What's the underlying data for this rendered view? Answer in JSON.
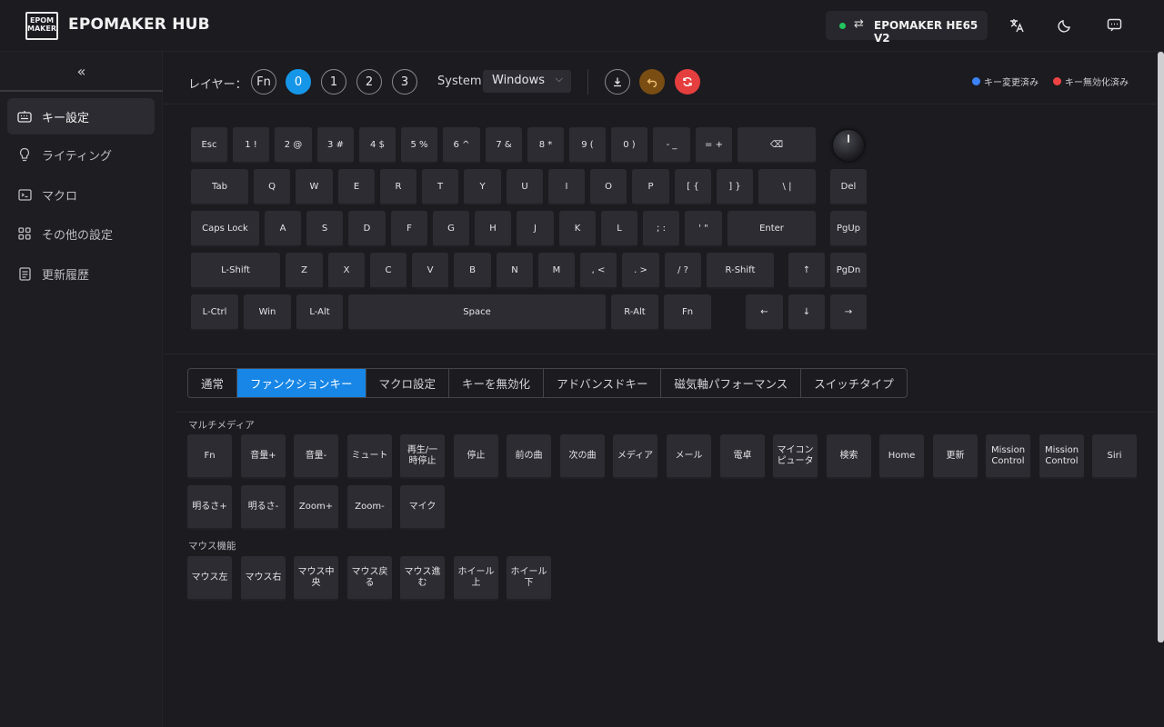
{
  "app": {
    "logo_text": "EPOM\nMAKER",
    "title": "EPOMAKER HUB"
  },
  "device": {
    "name": "EPOMAKER HE65 V2",
    "status_color": "#22c55e"
  },
  "sidebar": {
    "collapse_glyph": "«",
    "items": [
      {
        "label": "キー設定",
        "icon": "keyboard-icon",
        "active": true
      },
      {
        "label": "ライティング",
        "icon": "bulb-icon",
        "active": false
      },
      {
        "label": "マクロ",
        "icon": "terminal-icon",
        "active": false
      },
      {
        "label": "その他の設定",
        "icon": "grid-icon",
        "active": false
      },
      {
        "label": "更新履歴",
        "icon": "document-icon",
        "active": false
      }
    ]
  },
  "toolbar": {
    "layer_label": "レイヤー：",
    "layers": [
      "Fn",
      "0",
      "1",
      "2",
      "3"
    ],
    "active_layer": "0",
    "system_label": "System",
    "system_value": "Windows",
    "legend_remapped": "キー変更済み",
    "legend_disabled": "キー無効化済み",
    "colors": {
      "accent": "#1696e8",
      "remapped": "#3b82f6",
      "disabled": "#ef4444",
      "restore": "#7a4e12",
      "reset": "#e53e3e"
    }
  },
  "keyboard": {
    "rows": [
      [
        "Esc",
        "1 !",
        "2 @",
        "3 #",
        "4 $",
        "5 %",
        "6 ^",
        "7 &",
        "8 *",
        "9 (",
        "0 )",
        "- _",
        "= +",
        "⌫"
      ],
      [
        "Tab",
        "Q",
        "W",
        "E",
        "R",
        "T",
        "Y",
        "U",
        "I",
        "O",
        "P",
        "[ {",
        "] }",
        "\\ |",
        "Del"
      ],
      [
        "Caps Lock",
        "A",
        "S",
        "D",
        "F",
        "G",
        "H",
        "J",
        "K",
        "L",
        "; :",
        "' \"",
        "Enter",
        "PgUp"
      ],
      [
        "L-Shift",
        "Z",
        "X",
        "C",
        "V",
        "B",
        "N",
        "M",
        ", <",
        ". >",
        "/ ?",
        "R-Shift",
        "↑",
        "PgDn"
      ],
      [
        "L-Ctrl",
        "Win",
        "L-Alt",
        "Space",
        "R-Alt",
        "Fn",
        "←",
        "↓",
        "→"
      ]
    ]
  },
  "tabs": [
    "通常",
    "ファンクションキー",
    "マクロ設定",
    "キーを無効化",
    "アドバンスドキー",
    "磁気軸パフォーマンス",
    "スイッチタイプ"
  ],
  "active_tab": "ファンクションキー",
  "multimedia": {
    "title": "マルチメディア",
    "keys": [
      "Fn",
      "音量+",
      "音量-",
      "ミュート",
      "再生/一時停止",
      "停止",
      "前の曲",
      "次の曲",
      "メディア",
      "メール",
      "電卓",
      "マイコンピュータ",
      "検索",
      "Home",
      "更新",
      "Mission Control",
      "Mission Control",
      "Siri",
      "明るさ+",
      "明るさ-",
      "Zoom+",
      "Zoom-",
      "マイク"
    ]
  },
  "mouse": {
    "title": "マウス機能",
    "keys": [
      "マウス左",
      "マウス右",
      "マウス中央",
      "マウス戻る",
      "マウス進む",
      "ホイール上",
      "ホイール下"
    ]
  }
}
